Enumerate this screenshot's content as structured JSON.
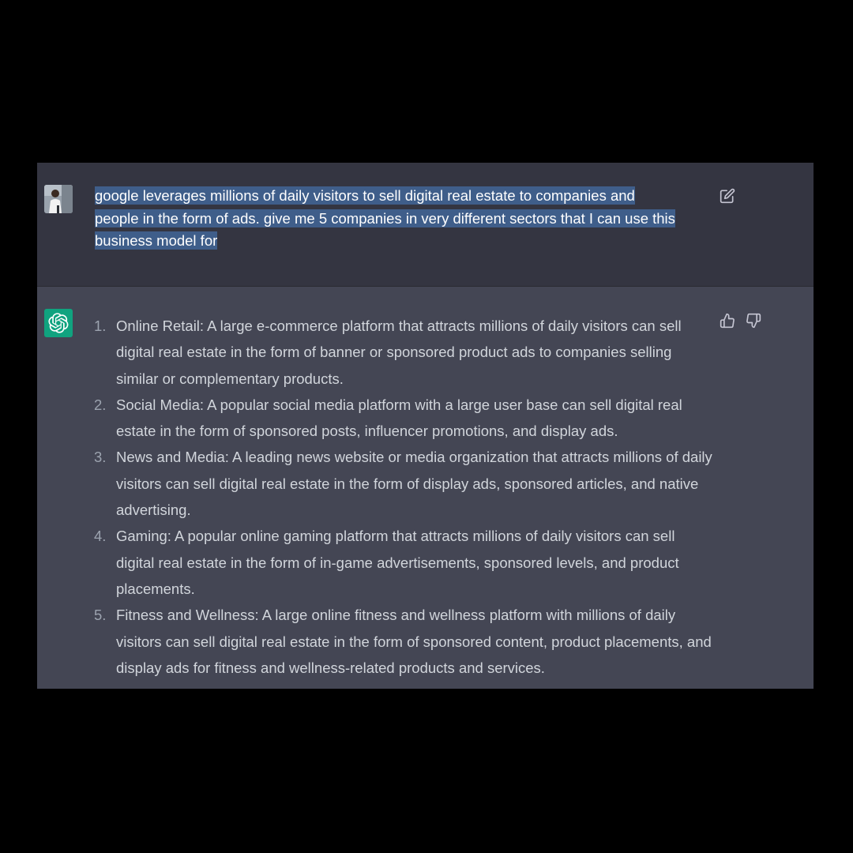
{
  "user_message": {
    "text": "google leverages millions of daily visitors to sell digital real estate to companies and people in the form of ads. give me 5 companies in very different sectors that I can use this business model for",
    "lines": [
      "google leverages millions of daily visitors to sell digital real estate to companies and",
      "people in the form of ads. give me 5 companies in very different sectors that I can use this",
      "business model for"
    ]
  },
  "assistant_message": {
    "items": [
      {
        "number": "1.",
        "text": "Online Retail: A large e-commerce platform that attracts millions of daily visitors can sell digital real estate in the form of banner or sponsored product ads to companies selling similar or complementary products."
      },
      {
        "number": "2.",
        "text": "Social Media: A popular social media platform with a large user base can sell digital real estate in the form of sponsored posts, influencer promotions, and display ads."
      },
      {
        "number": "3.",
        "text": "News and Media: A leading news website or media organization that attracts millions of daily visitors can sell digital real estate in the form of display ads, sponsored articles, and native advertising."
      },
      {
        "number": "4.",
        "text": "Gaming: A popular online gaming platform that attracts millions of daily visitors can sell digital real estate in the form of in-game advertisements, sponsored levels, and product placements."
      },
      {
        "number": "5.",
        "text": "Fitness and Wellness: A large online fitness and wellness platform with millions of daily visitors can sell digital real estate in the form of sponsored content, product placements, and display ads for fitness and wellness-related products and services."
      }
    ]
  },
  "icons": {
    "user_avatar": "user-avatar",
    "assistant_avatar": "openai-logo-icon",
    "edit": "edit-icon",
    "thumb_up": "thumbs-up-icon",
    "thumb_down": "thumbs-down-icon"
  },
  "colors": {
    "user_bg": "#343541",
    "assistant_bg": "#444654",
    "selection": "#3f5e8a",
    "brand_green": "#10a37f"
  }
}
